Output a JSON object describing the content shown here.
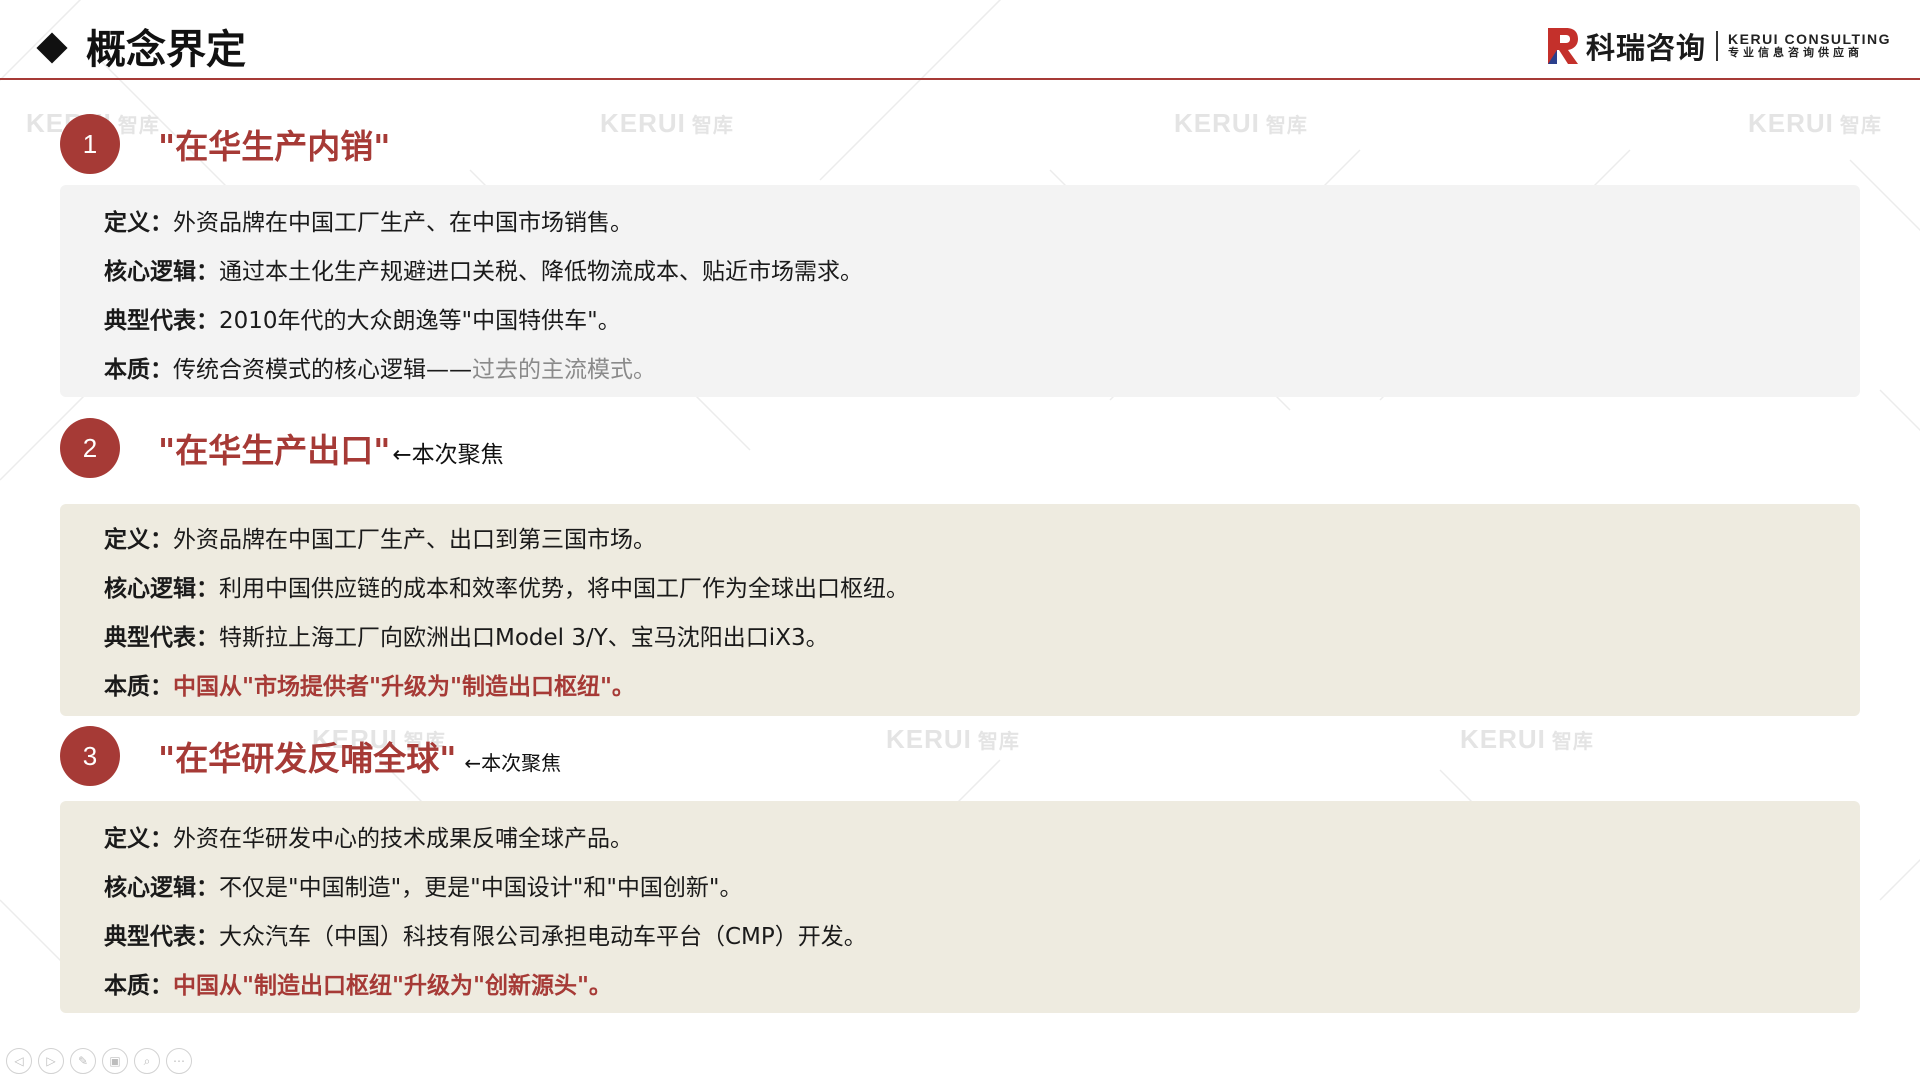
{
  "header": {
    "title": "概念界定",
    "brand_cn": "科瑞咨询",
    "brand_en": "KERUI CONSULTING",
    "brand_tagline": "专业信息咨询供应商"
  },
  "watermark": {
    "text": "KERUI",
    "sub": "智库"
  },
  "sections": [
    {
      "number": "1",
      "title": "\"在华生产内销\"",
      "note": "",
      "rows": [
        {
          "label": "定义：",
          "text": "外资品牌在中国工厂生产、在中国市场销售。"
        },
        {
          "label": "核心逻辑：",
          "text": "通过本土化生产规避进口关税、降低物流成本、贴近市场需求。"
        },
        {
          "label": "典型代表：",
          "text": "2010年代的大众朗逸等\"中国特供车\"。"
        },
        {
          "label": "本质：",
          "text": "传统合资模式的核心逻辑——",
          "extra": "过去的主流模式。"
        }
      ]
    },
    {
      "number": "2",
      "title": "\"在华生产出口\"",
      "note": "←本次聚焦",
      "rows": [
        {
          "label": "定义：",
          "text": "外资品牌在中国工厂生产、出口到第三国市场。"
        },
        {
          "label": "核心逻辑：",
          "text": "利用中国供应链的成本和效率优势，将中国工厂作为全球出口枢纽。"
        },
        {
          "label": "典型代表：",
          "text": "特斯拉上海工厂向欧洲出口Model 3/Y、宝马沈阳出口iX3。"
        },
        {
          "label": "本质：",
          "text": "中国从\"市场提供者\"升级为\"制造出口枢纽\"。"
        }
      ]
    },
    {
      "number": "3",
      "title": "\"在华研发反哺全球\"",
      "note": "←本次聚焦",
      "rows": [
        {
          "label": "定义：",
          "text": "外资在华研发中心的技术成果反哺全球产品。"
        },
        {
          "label": "核心逻辑：",
          "text": "不仅是\"中国制造\"，更是\"中国设计\"和\"中国创新\"。"
        },
        {
          "label": "典型代表：",
          "text": "大众汽车（中国）科技有限公司承担电动车平台（CMP）开发。"
        },
        {
          "label": "本质：",
          "text": "中国从\"制造出口枢纽\"升级为\"创新源头\"。"
        }
      ]
    }
  ],
  "toolbar": [
    {
      "icon": "prev-icon",
      "glyph": "◁"
    },
    {
      "icon": "next-icon",
      "glyph": "▷"
    },
    {
      "icon": "pen-icon",
      "glyph": "✎"
    },
    {
      "icon": "slides-icon",
      "glyph": "▣"
    },
    {
      "icon": "zoom-icon",
      "glyph": "⌕"
    },
    {
      "icon": "more-icon",
      "glyph": "⋯"
    }
  ],
  "colors": {
    "accent": "#a63a36",
    "card_gray": "#f3f3f3",
    "card_beige": "#eeebe0"
  }
}
